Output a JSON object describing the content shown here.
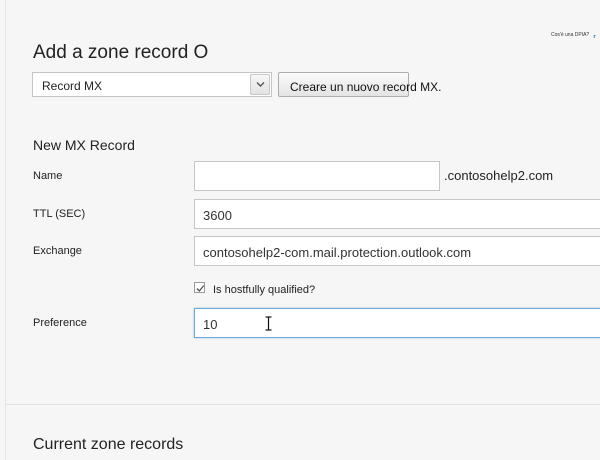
{
  "header": {
    "help_link": "Cos'è una DPIA?",
    "title": "Add a zone record O"
  },
  "record_type": {
    "selected": "Record MX"
  },
  "create_button": {
    "label": "Creare un nuovo record MX."
  },
  "form": {
    "section_title": "New MX Record",
    "name": {
      "label": "Name",
      "value": "",
      "suffix": ".contosohelp2.com"
    },
    "ttl": {
      "label": "TTL (SEC)",
      "value": "3600"
    },
    "exchange": {
      "label": "Exchange",
      "value": "contosohelp2-com.mail.protection.outlook.com"
    },
    "fully_qualified": {
      "label": "Is hostfully qualified?",
      "checked": true
    },
    "preference": {
      "label": "Preference",
      "value": "10"
    }
  },
  "current_records": {
    "title": "Current zone records"
  }
}
